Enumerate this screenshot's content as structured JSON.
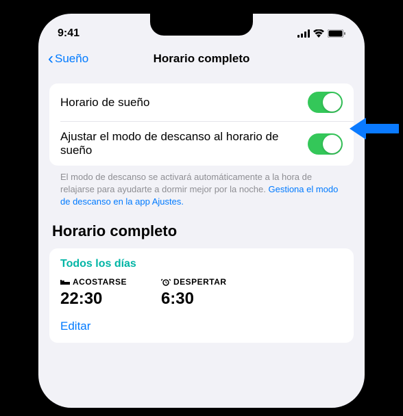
{
  "status": {
    "time": "9:41"
  },
  "nav": {
    "back_label": "Sueño",
    "title": "Horario completo"
  },
  "toggles": {
    "sleep_schedule": {
      "label": "Horario de sueño",
      "on": true
    },
    "wind_down": {
      "label": "Ajustar el modo de descanso al horario de sueño",
      "on": true
    }
  },
  "footer": {
    "text": "El modo de descanso se activará automáticamente a la hora de relajarse para ayudarte a dormir mejor por la noche. ",
    "link": "Gestiona el modo de descanso en la app Ajustes."
  },
  "section": {
    "header": "Horario completo",
    "schedule": {
      "days": "Todos los días",
      "bedtime_label": "ACOSTARSE",
      "bedtime_value": "22:30",
      "wake_label": "DESPERTAR",
      "wake_value": "6:30",
      "edit": "Editar"
    }
  }
}
